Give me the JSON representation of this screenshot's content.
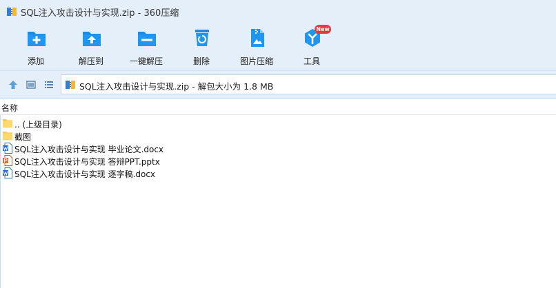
{
  "window": {
    "title": "SQL注入攻击设计与实现.zip - 360压缩",
    "app_icon": "archive-app-icon"
  },
  "toolbar": {
    "items": [
      {
        "label": "添加",
        "icon": "add-folder-icon"
      },
      {
        "label": "解压到",
        "icon": "extract-folder-icon"
      },
      {
        "label": "一键解压",
        "icon": "one-click-extract-icon"
      },
      {
        "label": "删除",
        "icon": "recycle-bin-icon"
      },
      {
        "label": "图片压缩",
        "icon": "image-compress-icon"
      },
      {
        "label": "工具",
        "icon": "tools-icon",
        "badge": "New"
      }
    ],
    "accent_color": "#1a8be0",
    "badge_color": "#e83a3a"
  },
  "navbar": {
    "up_icon": "up-arrow-icon",
    "thumbnail_view_icon": "thumbnail-view-icon",
    "list_view_icon": "list-view-icon",
    "path_text": "SQL注入攻击设计与实现.zip - 解包大小为 1.8 MB"
  },
  "list": {
    "column_name": "名称",
    "rows": [
      {
        "name": ".. (上级目录)",
        "icon": "folder-icon"
      },
      {
        "name": "截图",
        "icon": "folder-icon"
      },
      {
        "name": "SQL注入攻击设计与实现 毕业论文.docx",
        "icon": "word-doc-icon"
      },
      {
        "name": "SQL注入攻击设计与实现 答辩PPT.pptx",
        "icon": "powerpoint-icon"
      },
      {
        "name": "SQL注入攻击设计与实现 逐字稿.docx",
        "icon": "word-doc-icon"
      }
    ]
  }
}
